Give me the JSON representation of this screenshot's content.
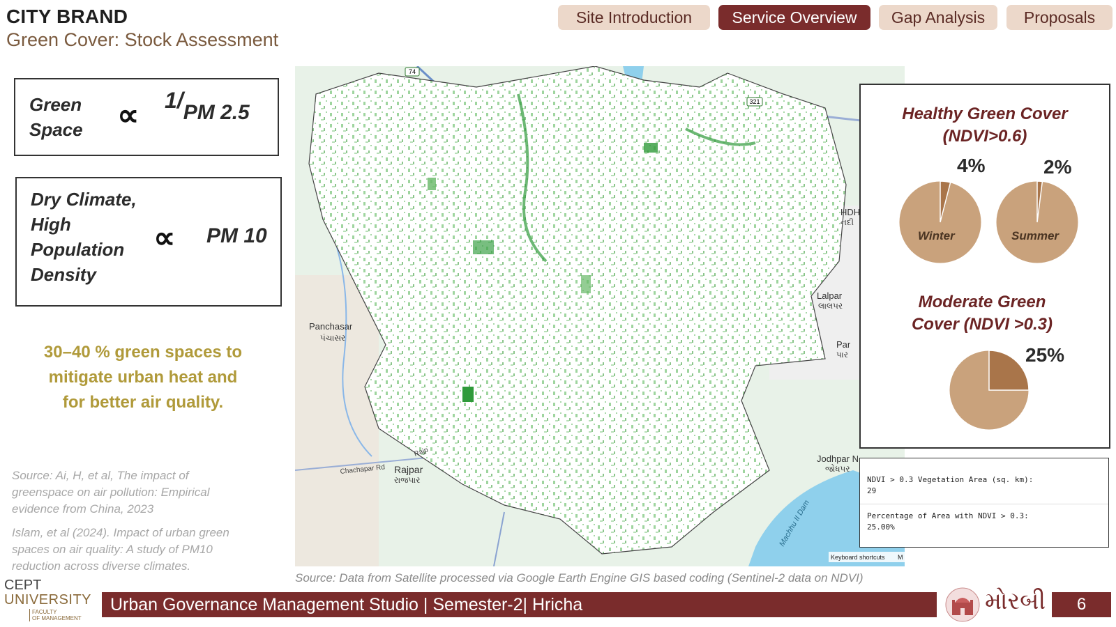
{
  "header": {
    "brand": "CITY BRAND",
    "subtitle": "Green Cover: Stock Assessment",
    "tabs": [
      {
        "label": "Site Introduction",
        "active": false
      },
      {
        "label": "Service Overview",
        "active": true
      },
      {
        "label": "Gap Analysis",
        "active": false
      },
      {
        "label": "Proposals",
        "active": false
      }
    ]
  },
  "left": {
    "box1": {
      "line1": "Green",
      "line2": "Space",
      "symbol": "∝",
      "numerator": "1/",
      "denominator": "PM 2.5"
    },
    "box2": {
      "line1": "Dry Climate,",
      "line2": "High",
      "line3": "Population",
      "line4": "Density",
      "symbol": "∝",
      "rhs": "PM 10"
    },
    "note": [
      "30–40 % green spaces to",
      "mitigate urban heat and",
      "for better air quality."
    ],
    "sources": [
      [
        "Source: Ai, H, et al, The impact of",
        "greenspace on air pollution: Empirical",
        "evidence from China, 2023"
      ],
      [
        "Islam, et al (2024). Impact of urban green",
        "spaces on air quality: A study of PM10",
        "reduction across diverse climates."
      ]
    ]
  },
  "map": {
    "labels": {
      "panchasar": "Panchasar",
      "panchasar_gu": "પંચાસર",
      "rajpar": "Rajpar",
      "rajpar_gu": "રાજપાર",
      "chachapar": "Chachapar Rd",
      "raj": "Rajp",
      "lalpar": "Lalpar",
      "lalpar_gu": "લાલપર",
      "jodhpar": "Jodhpar N",
      "jodhpar_gu": "જોધપર",
      "par": "Par",
      "par_gu": "પાર",
      "hdh": "HDH",
      "hdh_gu": "નદી",
      "dam": "Machhu II Dam",
      "hwy74": "74",
      "hwy321": "321",
      "shortcuts": "Keyboard shortcuts",
      "m": "M"
    },
    "source": "Source: Data from Satellite processed via Google Earth Engine GIS based coding (Sentinel-2 data on NDVI)"
  },
  "panel": {
    "healthy_title": [
      "Healthy Green Cover",
      "(NDVI>0.6)"
    ],
    "winter": {
      "label": "Winter",
      "percent_text": "4%",
      "value": 4
    },
    "summer": {
      "label": "Summer",
      "percent_text": "2%",
      "value": 2
    },
    "moderate_title": [
      "Moderate Green",
      "Cover (NDVI >0.3)"
    ],
    "moderate": {
      "percent_text": "25%",
      "value": 25
    },
    "colors": {
      "pie_base": "#c9a27c",
      "pie_slice": "#a9754a"
    }
  },
  "code": {
    "line1": "NDVI > 0.3 Vegetation Area (sq. km):",
    "line2": "29",
    "line3": "Percentage of Area with NDVI > 0.3:",
    "line4": "25.00%"
  },
  "footer": {
    "university_line1": "CEPT",
    "university_line2": "UNIVERSITY",
    "faculty_line1": "FACULTY",
    "faculty_line2": "OF MANAGEMENT",
    "studio": "Urban Governance Management Studio | Semester-2| Hricha",
    "city_gu": "મોરબી",
    "page": "6"
  }
}
